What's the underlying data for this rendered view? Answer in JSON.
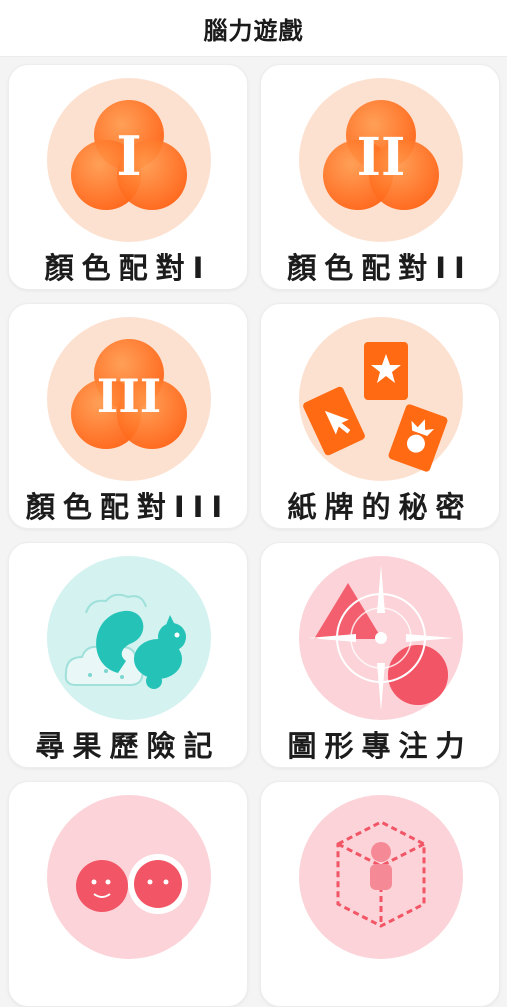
{
  "header": {
    "title": "腦力遊戲"
  },
  "games": [
    {
      "label": "顏色配對I",
      "numeral": "I"
    },
    {
      "label": "顏色配對II",
      "numeral": "II"
    },
    {
      "label": "顏色配對III",
      "numeral": "III"
    },
    {
      "label": "紙牌的秘密"
    },
    {
      "label": "尋果歷險記"
    },
    {
      "label": "圖形專注力"
    },
    {
      "label": ""
    },
    {
      "label": ""
    }
  ],
  "colors": {
    "orange": "#ff6a13",
    "orange_light": "#ff9a4d",
    "peach_bg": "#fde1d0",
    "teal_bg": "#d3f2f0",
    "teal": "#25c3b7",
    "pink_bg": "#fbd3d8",
    "red": "#f25565"
  }
}
